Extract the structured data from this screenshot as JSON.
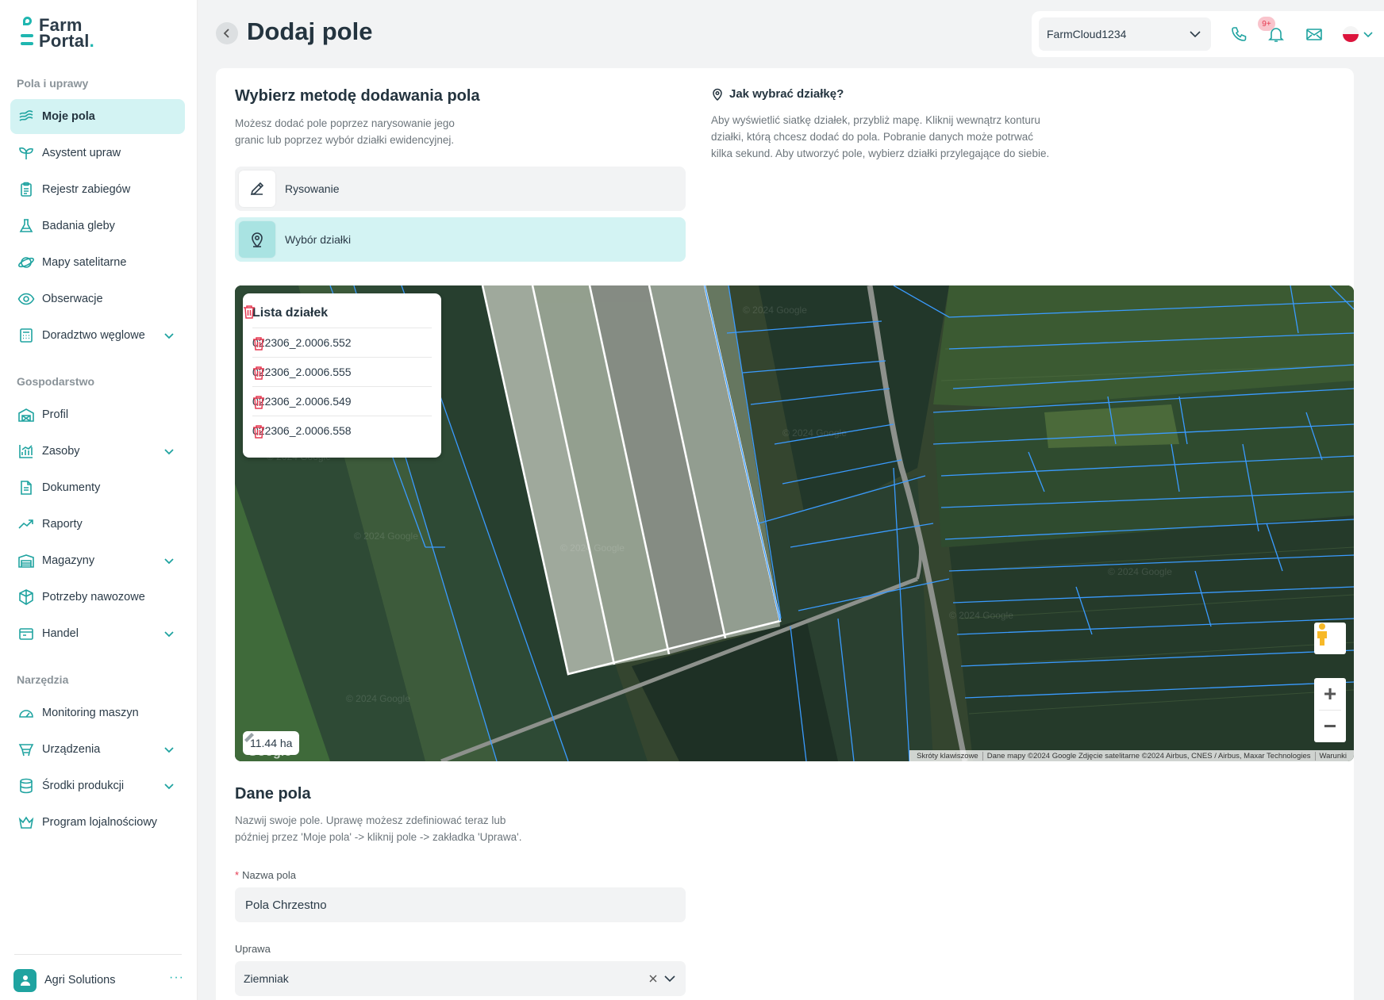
{
  "brand": {
    "line1": "Farm",
    "line2": "Portal",
    "dot": "."
  },
  "sidebar": {
    "sections": [
      {
        "title": "Pola i uprawy"
      },
      {
        "title": "Gospodarstwo"
      },
      {
        "title": "Narzędzia"
      }
    ],
    "items": [
      {
        "label": "Moje pola",
        "icon": "fields-icon"
      },
      {
        "label": "Asystent upraw",
        "icon": "sprout-icon"
      },
      {
        "label": "Rejestr zabiegów",
        "icon": "clipboard-icon"
      },
      {
        "label": "Badania gleby",
        "icon": "flask-icon"
      },
      {
        "label": "Mapy satelitarne",
        "icon": "planet-icon"
      },
      {
        "label": "Obserwacje",
        "icon": "eye-icon"
      },
      {
        "label": "Doradztwo węglowe",
        "icon": "calculator-icon"
      },
      {
        "label": "Profil",
        "icon": "barn-icon"
      },
      {
        "label": "Zasoby",
        "icon": "chart-icon"
      },
      {
        "label": "Dokumenty",
        "icon": "document-icon"
      },
      {
        "label": "Raporty",
        "icon": "trend-icon"
      },
      {
        "label": "Magazyny",
        "icon": "warehouse-icon"
      },
      {
        "label": "Potrzeby nawozowe",
        "icon": "fertilizer-icon"
      },
      {
        "label": "Handel",
        "icon": "trade-icon"
      },
      {
        "label": "Monitoring maszyn",
        "icon": "gauge-icon"
      },
      {
        "label": "Urządzenia",
        "icon": "devices-icon"
      },
      {
        "label": "Środki produkcji",
        "icon": "database-icon"
      },
      {
        "label": "Program lojalnościowy",
        "icon": "crown-icon"
      }
    ],
    "user": {
      "name": "Agri Solutions",
      "more": "···"
    }
  },
  "header": {
    "title": "Dodaj pole",
    "farm_select": "FarmCloud1234",
    "notifications_badge": "9+"
  },
  "method": {
    "title": "Wybierz metodę dodawania pola",
    "desc_line1": "Możesz dodać pole poprzez narysowanie jego",
    "desc_line2": "granic lub poprzez wybór działki ewidencyjnej.",
    "options": [
      {
        "label": "Rysowanie",
        "selected": false
      },
      {
        "label": "Wybór działki",
        "selected": true
      }
    ]
  },
  "howto": {
    "title": "Jak wybrać działkę?",
    "line1": "Aby wyświetlić siatkę działek, przybliż mapę. Kliknij wewnątrz konturu",
    "line2": "działki, którą chcesz dodać do pola. Pobranie danych może potrwać",
    "line3": "kilka sekund. Aby utworzyć pole, wybierz działki przylegające do siebie."
  },
  "parcels": {
    "title": "Lista działek",
    "items": [
      "022306_2.0006.552",
      "022306_2.0006.555",
      "022306_2.0006.549",
      "022306_2.0006.558"
    ]
  },
  "map": {
    "area": "11.44 ha",
    "attribution": [
      "Skróty klawiszowe",
      "Dane mapy ©2024 Google Zdjęcie satelitarne ©2024 Airbus, CNES / Airbus, Maxar Technologies",
      "Warunki"
    ],
    "google": "Google"
  },
  "form": {
    "title": "Dane pola",
    "desc_line1": "Nazwij swoje pole. Uprawę możesz zdefiniować teraz lub",
    "desc_line2": "później przez 'Moje pola' -> kliknij pole -> zakładka 'Uprawa'.",
    "name_label": "Nazwa pola",
    "name_required": "*",
    "name_value": "Pola Chrzestno",
    "crop_label": "Uprawa",
    "crop_value": "Ziemniak"
  },
  "colors": {
    "accent": "#1fb6b0",
    "active_bg": "#d3f3f3",
    "danger": "#e53950",
    "parcel_line": "#3a9bff"
  }
}
